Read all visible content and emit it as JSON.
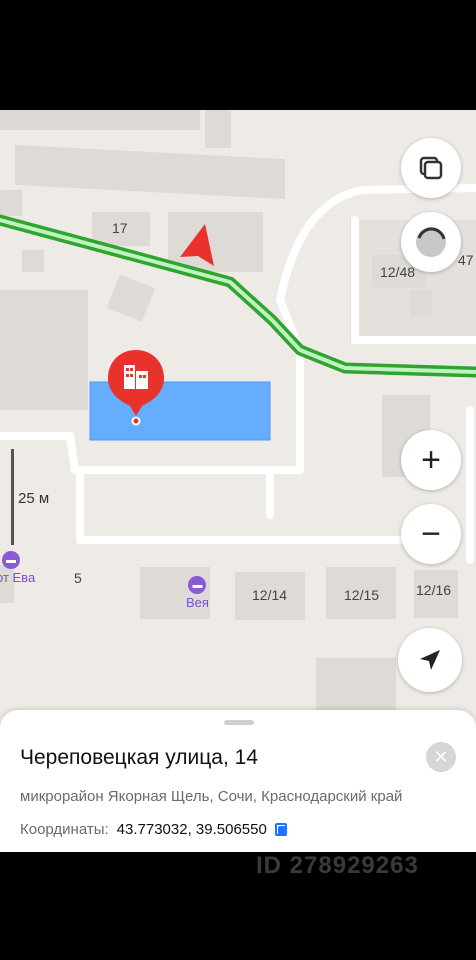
{
  "map": {
    "buildings": [
      {
        "label": "17"
      },
      {
        "label": "12/48"
      },
      {
        "label": "47"
      },
      {
        "label": "5"
      },
      {
        "label": "12/14"
      },
      {
        "label": "12/15"
      },
      {
        "label": "12/16"
      }
    ],
    "pois": [
      {
        "label": "Вея",
        "icon": "hotel-icon"
      },
      {
        "label": "от Ева",
        "icon": "hotel-icon"
      }
    ],
    "scale": "25 м",
    "route_color": "#5fd85f",
    "highlight_color": "#66adff",
    "marker_color": "#e8322b",
    "marker_icon": "building-icon"
  },
  "controls": {
    "layers_icon": "layers-icon",
    "traffic_icon": "traffic-icon",
    "zoom_in": "+",
    "zoom_out": "−",
    "locate_icon": "location-arrow-icon"
  },
  "place": {
    "title": "Череповецкая улица, 14",
    "subtitle": "микрорайон Якорная Щель, Сочи, Краснодарский край",
    "coords_label": "Координаты:",
    "coords_value": "43.773032, 39.506550",
    "copy_icon": "copy-icon",
    "close_icon": "close-icon"
  },
  "watermark": {
    "id_text": "ID 278929263"
  }
}
